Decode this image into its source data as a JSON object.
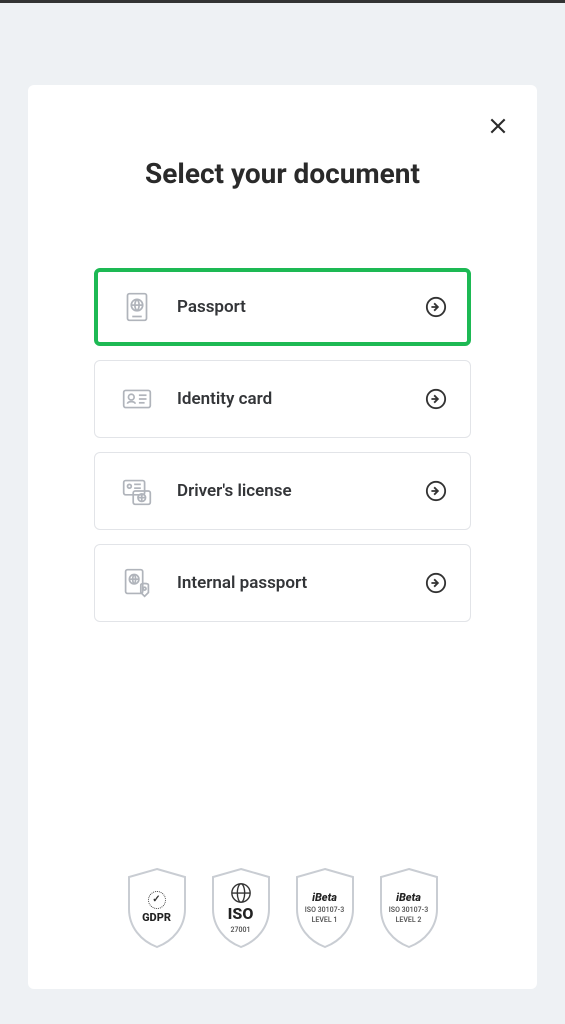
{
  "title": "Select your document",
  "options": [
    {
      "label": "Passport",
      "selected": true
    },
    {
      "label": "Identity card",
      "selected": false
    },
    {
      "label": "Driver's license",
      "selected": false
    },
    {
      "label": "Internal passport",
      "selected": false
    }
  ],
  "badges": {
    "gdpr": "GDPR",
    "iso_main": "ISO",
    "iso_sub": "27001",
    "ibeta1_main": "iBeta",
    "ibeta1_sub1": "ISO 30107-3",
    "ibeta1_sub2": "LEVEL 1",
    "ibeta2_main": "iBeta",
    "ibeta2_sub1": "ISO 30107-3",
    "ibeta2_sub2": "LEVEL 2"
  }
}
